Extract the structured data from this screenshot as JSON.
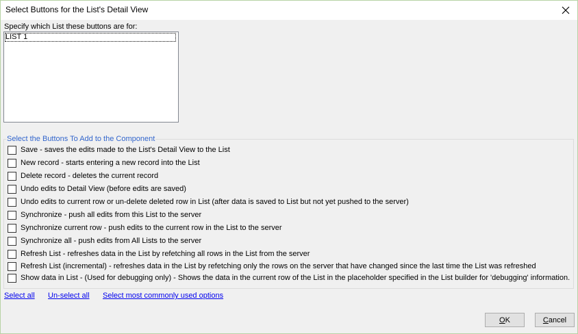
{
  "window": {
    "title": "Select Buttons for the List's Detail View"
  },
  "list_section": {
    "label": "Specify which List these buttons are for:",
    "items": [
      "LIST 1"
    ]
  },
  "buttons_group": {
    "legend": "Select the Buttons To Add to the Component",
    "options": [
      {
        "label": "Save - saves the edits made to the List's Detail View to the List",
        "checked": false
      },
      {
        "label": "New record - starts entering a new record into the List",
        "checked": false
      },
      {
        "label": "Delete record - deletes the current record",
        "checked": false
      },
      {
        "label": "Undo edits to Detail View (before edits are saved)",
        "checked": false
      },
      {
        "label": "Undo edits to current row or un-delete deleted row in List (after data is saved to List but not yet pushed to the server)",
        "checked": false
      },
      {
        "label": "Synchronize - push all edits from this List to the server",
        "checked": false
      },
      {
        "label": "Synchronize current row - push edits to the current row in the List to the server",
        "checked": false
      },
      {
        "label": "Synchronize all - push edits from All Lists to the server",
        "checked": false
      },
      {
        "label": "Refresh List - refreshes data in the List by refetching all rows in the List from the server",
        "checked": false
      },
      {
        "label": "Refresh List (incremental) - refreshes data in the List by refetching only the rows on the server that have changed since the last time the List was refreshed",
        "checked": false
      },
      {
        "label": "Show data in List - (Used for debugging only) - Shows the data in the current row of the List in the placeholder specified in the List builder for 'debugging' information.",
        "checked": false
      }
    ]
  },
  "links": {
    "select_all": "Select all",
    "unselect_all": "Un-select all",
    "common": "Select most commonly used options"
  },
  "footer": {
    "ok_mnemonic": "O",
    "ok_rest": "K",
    "cancel_mnemonic": "C",
    "cancel_rest": "ancel"
  }
}
